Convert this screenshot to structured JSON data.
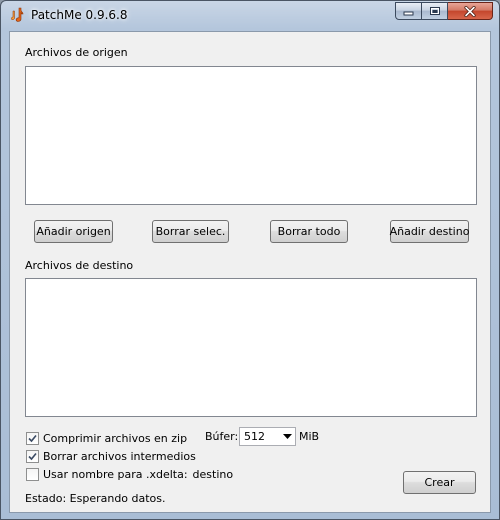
{
  "window": {
    "title": "PatchMe 0.9.6.8"
  },
  "source": {
    "label": "Archivos de origen"
  },
  "buttons": {
    "add_source": "Añadir origen",
    "delete_selected": "Borrar selec.",
    "delete_all": "Borrar todo",
    "add_destination": "Añadir destino",
    "create": "Crear"
  },
  "destination": {
    "label": "Archivos de destino"
  },
  "options": {
    "compress_zip": {
      "label": "Comprimir archivos en zip",
      "checked": true
    },
    "delete_intermediate": {
      "label": "Borrar archivos intermedios",
      "checked": true
    },
    "use_name_prefix": {
      "label": "Usar nombre para .xdelta:",
      "checked": false
    },
    "use_name_value": "destino"
  },
  "buffer": {
    "label": "Búfer:",
    "value": "512",
    "unit": "MiB"
  },
  "status": {
    "text": "Estado: Esperando datos."
  },
  "icons": {
    "app": "music-note-icon",
    "minimize": "minimize-icon",
    "maximize": "maximize-icon",
    "close": "close-icon",
    "check": "checkmark-icon",
    "dropdown": "chevron-down-icon"
  },
  "colors": {
    "close_button": "#c4462c",
    "frame": "#b4c6dc",
    "client_bg": "#f0f0f0"
  }
}
